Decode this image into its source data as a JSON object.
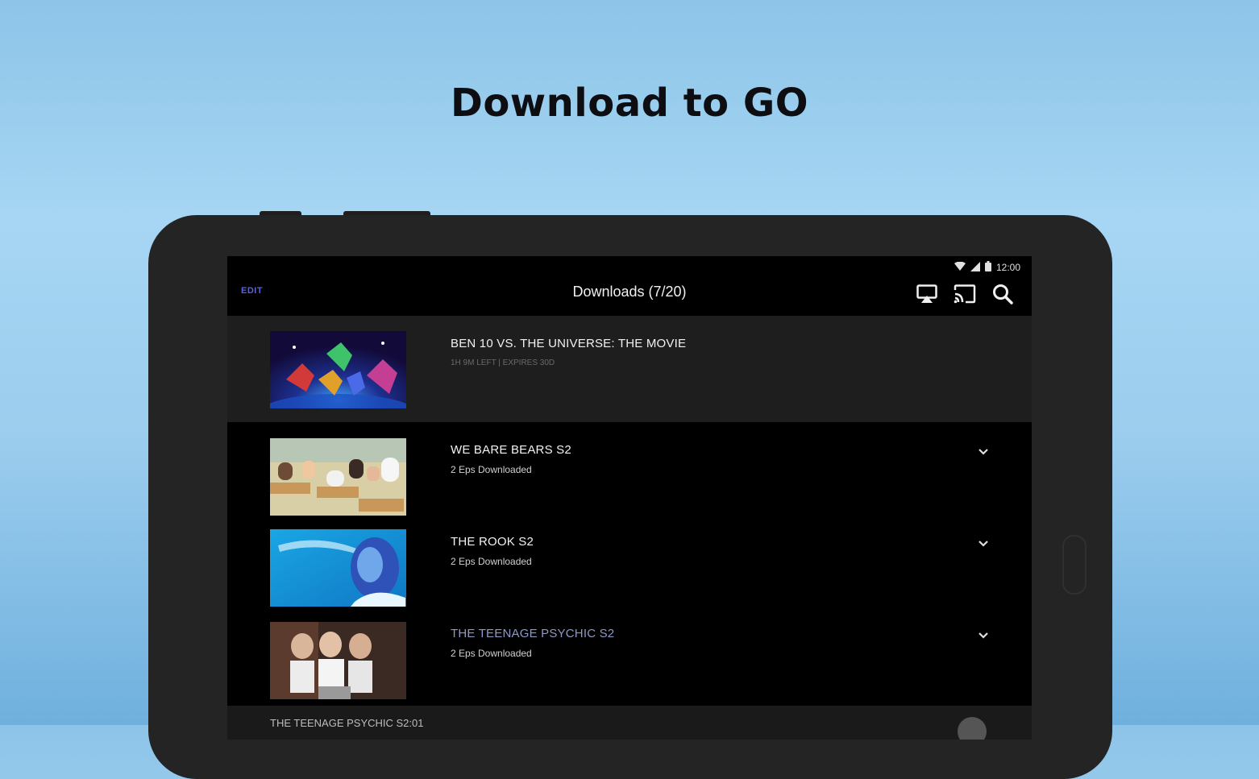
{
  "headline": "Download to GO",
  "status_bar": {
    "time": "12:00"
  },
  "app_bar": {
    "edit_label": "EDIT",
    "title": "Downloads (7/20)"
  },
  "downloads": [
    {
      "title": "BEN 10 VS. THE UNIVERSE: THE MOVIE",
      "subtitle": "1H 9M LEFT | EXPIRES 30D",
      "highlighted": true,
      "expandable": false
    },
    {
      "title": "WE BARE BEARS S2",
      "subtitle": "2 Eps Downloaded",
      "highlighted": false,
      "expandable": true
    },
    {
      "title": "THE ROOK S2",
      "subtitle": "2 Eps Downloaded",
      "highlighted": false,
      "expandable": true
    },
    {
      "title": "THE TEENAGE PSYCHIC S2",
      "subtitle": "2 Eps Downloaded",
      "highlighted": false,
      "expandable": true,
      "title_color": "#8d99c9"
    }
  ],
  "next_item": {
    "label": "THE TEENAGE PSYCHIC S2:01"
  },
  "colors": {
    "accent": "#5b63d6",
    "background_top": "#8dc4e8",
    "background_bottom": "#6fb0de",
    "screen": "#000000",
    "highlight_row": "#1e1e1e"
  },
  "icons": [
    "wifi-icon",
    "signal-icon",
    "battery-icon",
    "airplay-icon",
    "cast-icon",
    "search-icon",
    "chevron-down-icon"
  ]
}
